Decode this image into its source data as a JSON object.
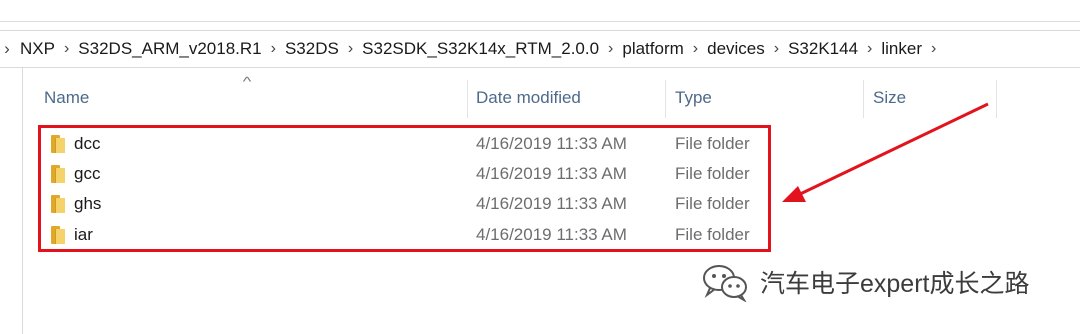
{
  "breadcrumb": {
    "items": [
      "NXP",
      "S32DS_ARM_v2018.R1",
      "S32DS",
      "S32SDK_S32K14x_RTM_2.0.0",
      "platform",
      "devices",
      "S32K144",
      "linker"
    ]
  },
  "columns": {
    "name": "Name",
    "date": "Date modified",
    "type": "Type",
    "size": "Size"
  },
  "files": [
    {
      "name": "dcc",
      "date": "4/16/2019 11:33 AM",
      "type": "File folder"
    },
    {
      "name": "gcc",
      "date": "4/16/2019 11:33 AM",
      "type": "File folder"
    },
    {
      "name": "ghs",
      "date": "4/16/2019 11:33 AM",
      "type": "File folder"
    },
    {
      "name": "iar",
      "date": "4/16/2019 11:33 AM",
      "type": "File folder"
    }
  ],
  "annotation": {
    "highlight_color": "#e3131e",
    "arrow_color": "#e3131e"
  },
  "watermark": {
    "text": "汽车电子expert成长之路",
    "icon": "wechat-icon"
  },
  "colors": {
    "header_text": "#4d6a8a",
    "folder_back": "#e0a92c",
    "folder_front": "#f5d36a"
  }
}
